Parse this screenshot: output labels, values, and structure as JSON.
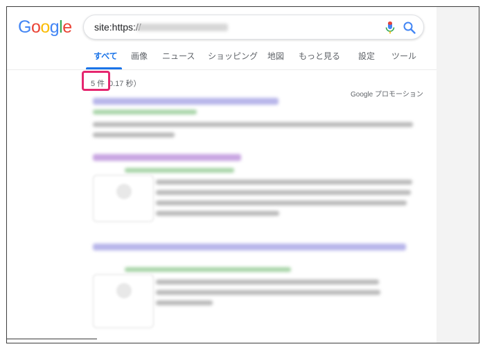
{
  "search": {
    "query_prefix": "site:https://",
    "mic_icon": "mic-icon",
    "search_icon": "search-icon"
  },
  "logo": {
    "letters": [
      "G",
      "o",
      "o",
      "g",
      "l",
      "e"
    ]
  },
  "colors": {
    "google_blue": "#4285f4",
    "google_red": "#ea4335",
    "google_yellow": "#fbbc05",
    "google_green": "#34a853",
    "active_tab": "#1a73e8",
    "highlight_box": "#e5266f"
  },
  "tabs": [
    {
      "label": "すべて",
      "active": true
    },
    {
      "label": "画像",
      "active": false
    },
    {
      "label": "ニュース",
      "active": false
    },
    {
      "label": "ショッピング",
      "active": false
    },
    {
      "label": "地図",
      "active": false
    },
    {
      "label": "もっと見る",
      "active": false
    },
    {
      "label": "設定",
      "active": false
    },
    {
      "label": "ツール",
      "active": false
    }
  ],
  "stats": {
    "count": "5 件",
    "time": "0.17 秒）"
  },
  "promo": "Google プロモーション"
}
